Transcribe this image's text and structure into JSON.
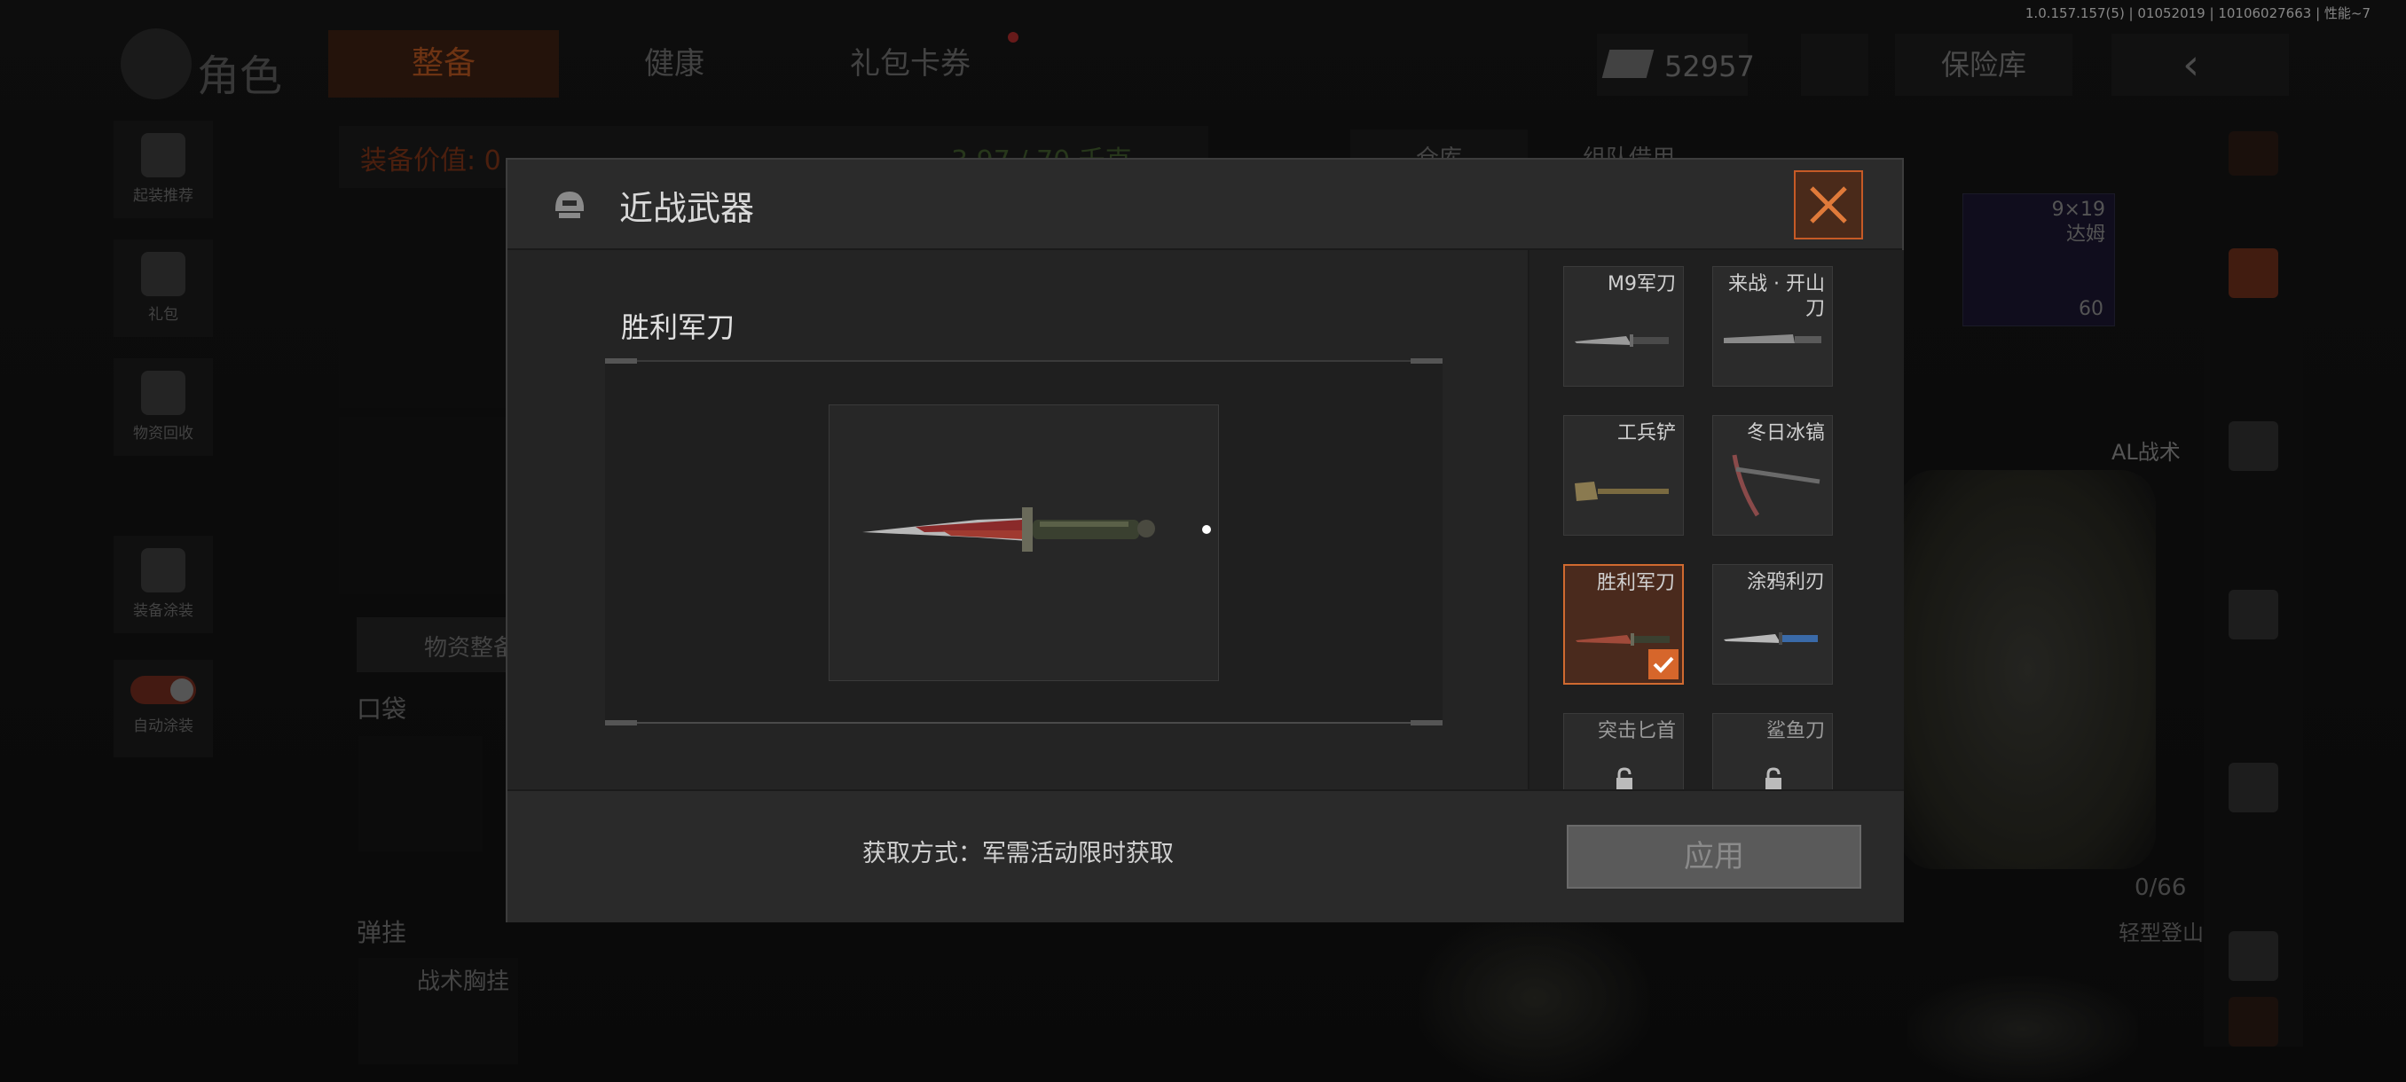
{
  "version_text": "1.0.157.157(5) | 01052019 | 10106027663 | 性能~7",
  "background": {
    "role_label": "角色",
    "tabs": [
      {
        "label": "整备",
        "active": true
      },
      {
        "label": "健康",
        "active": false
      },
      {
        "label": "礼包卡券",
        "active": false
      }
    ],
    "currency_value": "52957",
    "vault_label": "保险库",
    "left_sidebar": [
      {
        "label": "起装推荐"
      },
      {
        "label": "礼包"
      },
      {
        "label": "物资回收"
      },
      {
        "label": "装备涂装"
      },
      {
        "label": "自动涂装"
      }
    ],
    "equip_value_label": "装备价值: 0",
    "weight_label": "3.97 / 70 千克",
    "warehouse_tab": "仓库",
    "team_lend_tab": "组队借用",
    "supply_btn": "物资整备",
    "pocket_label": "口袋",
    "ammo_label": "弹挂",
    "chest_rig_label": "战术胸挂",
    "ammo_item": {
      "name": "9×19\n达姆",
      "count": "60"
    },
    "vest_label": "AL战术",
    "capacity": "0/66",
    "backpack_label": "轻型登山包"
  },
  "modal": {
    "title": "近战武器",
    "selected_item_name": "胜利军刀",
    "acquisition_text": "获取方式：军需活动限时获取",
    "apply_label": "应用",
    "items": [
      {
        "name": "M9军刀",
        "selected": false,
        "locked": false,
        "blade_color": "#9a9a9a"
      },
      {
        "name": "来战 · 开山刀",
        "selected": false,
        "locked": false,
        "blade_color": "#8a8a8a"
      },
      {
        "name": "工兵铲",
        "selected": false,
        "locked": false,
        "blade_color": "#8a7a50"
      },
      {
        "name": "冬日冰镐",
        "selected": false,
        "locked": false,
        "blade_color": "#8a4a4a"
      },
      {
        "name": "胜利军刀",
        "selected": true,
        "locked": false,
        "blade_color": "#a04a3a"
      },
      {
        "name": "涂鸦利刃",
        "selected": false,
        "locked": false,
        "blade_color": "#3a6aa8"
      },
      {
        "name": "突击匕首",
        "selected": false,
        "locked": true,
        "blade_color": "#6a6a6a"
      },
      {
        "name": "鲨鱼刀",
        "selected": false,
        "locked": true,
        "blade_color": "#6a6a6a"
      }
    ]
  },
  "colors": {
    "accent_orange": "#d6662b",
    "modal_bg": "#242424"
  }
}
